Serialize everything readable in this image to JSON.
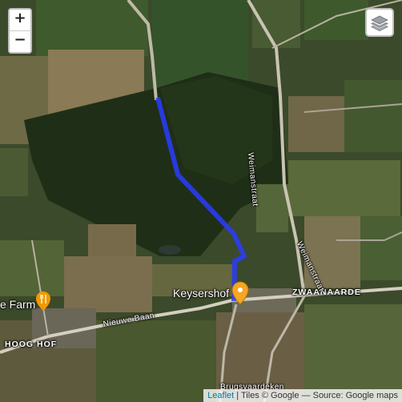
{
  "map": {
    "labels": {
      "keysershof": "Keysershof",
      "zwaanaarde": "ZWAANAARDE",
      "weimanstraat_north": "Weimanstraat",
      "weimanstraat_south": "Weimanstraat",
      "nieuwe_baan": "Nieuwe Baan",
      "hooghof": "HOOG HOF",
      "farm": "e Farm",
      "brugsvaardeken": "Brugsvaardeken"
    },
    "route_color": "#2a3cff",
    "marker_color": "#f5a623"
  },
  "controls": {
    "zoom_in": "+",
    "zoom_out": "−",
    "layers_icon": "layers-icon"
  },
  "attribution": {
    "leaflet": "Leaflet",
    "text": " | Tiles © Google — Source: Google maps"
  }
}
